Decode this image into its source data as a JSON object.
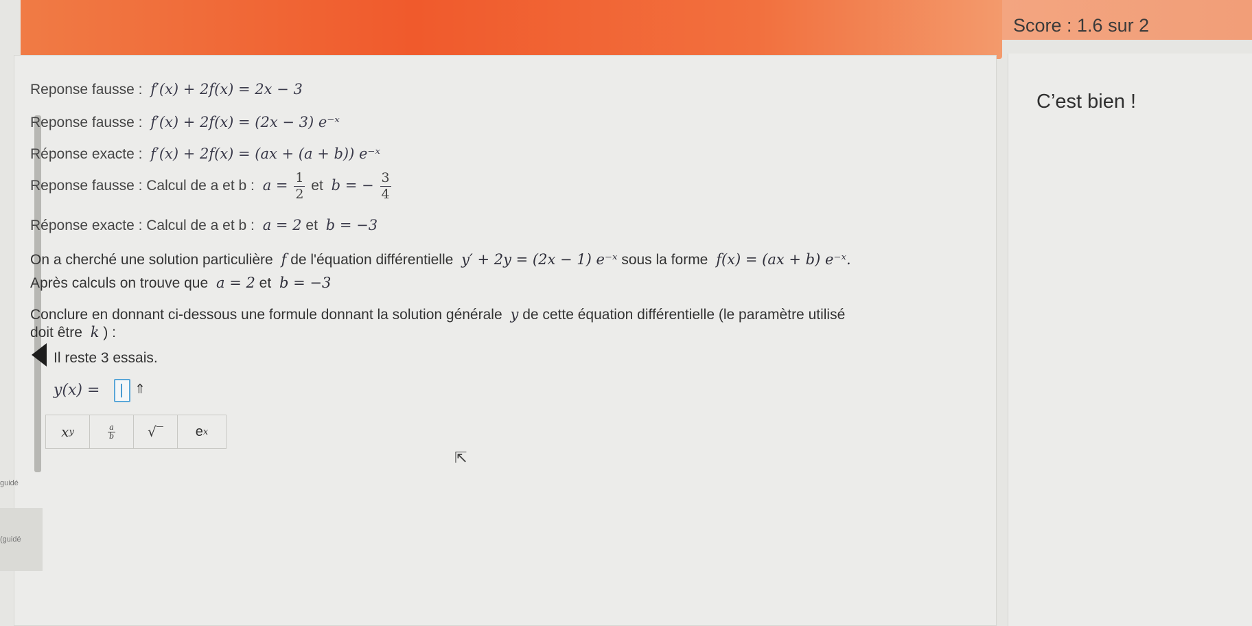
{
  "header": {
    "score": "Score : 1.6 sur 2"
  },
  "feedback": {
    "message": "C’est bien !"
  },
  "results": [
    {
      "prefix": "Reponse fausse :",
      "math": "f′(x) + 2f(x) = 2x − 3"
    },
    {
      "prefix": "Reponse fausse :",
      "math": "f′(x) + 2f(x) = (2x − 3) e⁻ˣ"
    },
    {
      "prefix": "Réponse exacte :",
      "math": "f′(x) + 2f(x) = (ax + (a + b)) e⁻ˣ"
    },
    {
      "prefix": "Reponse fausse : Calcul de a et b :",
      "math_a": "a =",
      "frac_num": "1",
      "frac_den": "2",
      "mid": "et",
      "math_b": "b = −",
      "frac2_num": "3",
      "frac2_den": "4"
    },
    {
      "prefix": "Réponse exacte : Calcul de a et b :",
      "math": "a = 2",
      "mid": "et",
      "math2": "b = −3"
    }
  ],
  "question": {
    "line1_a": "On a cherché une solution particulière",
    "line1_f": "f",
    "line1_b": "de l'équation différentielle",
    "line1_eq": "y′ + 2y = (2x − 1) e⁻ˣ",
    "line1_c": "sous la forme",
    "line1_form": "f(x) = (ax + b) e⁻ˣ.",
    "line2_a": "Après calculs on trouve que",
    "line2_math": "a = 2",
    "line2_mid": "et",
    "line2_math2": "b = −3",
    "line3_a": "Conclure en donnant ci-dessous une formule donnant la solution générale",
    "line3_y": "y",
    "line3_b": "de cette équation différentielle (le paramètre utilisé",
    "line4_a": "doit être",
    "line4_k": "k",
    "line4_b": ") :",
    "attempts": "Il reste 3 essais."
  },
  "answer": {
    "label": "y(x) =",
    "expand_icon": "⇑"
  },
  "toolbar": {
    "power_base": "x",
    "power_sup": "y",
    "frac_num": "a",
    "frac_den": "b",
    "sqrt": "√‾",
    "exp_base": "e",
    "exp_sup": "x"
  },
  "sidebar": {
    "label1": "guidé",
    "label2": "(guidé"
  }
}
